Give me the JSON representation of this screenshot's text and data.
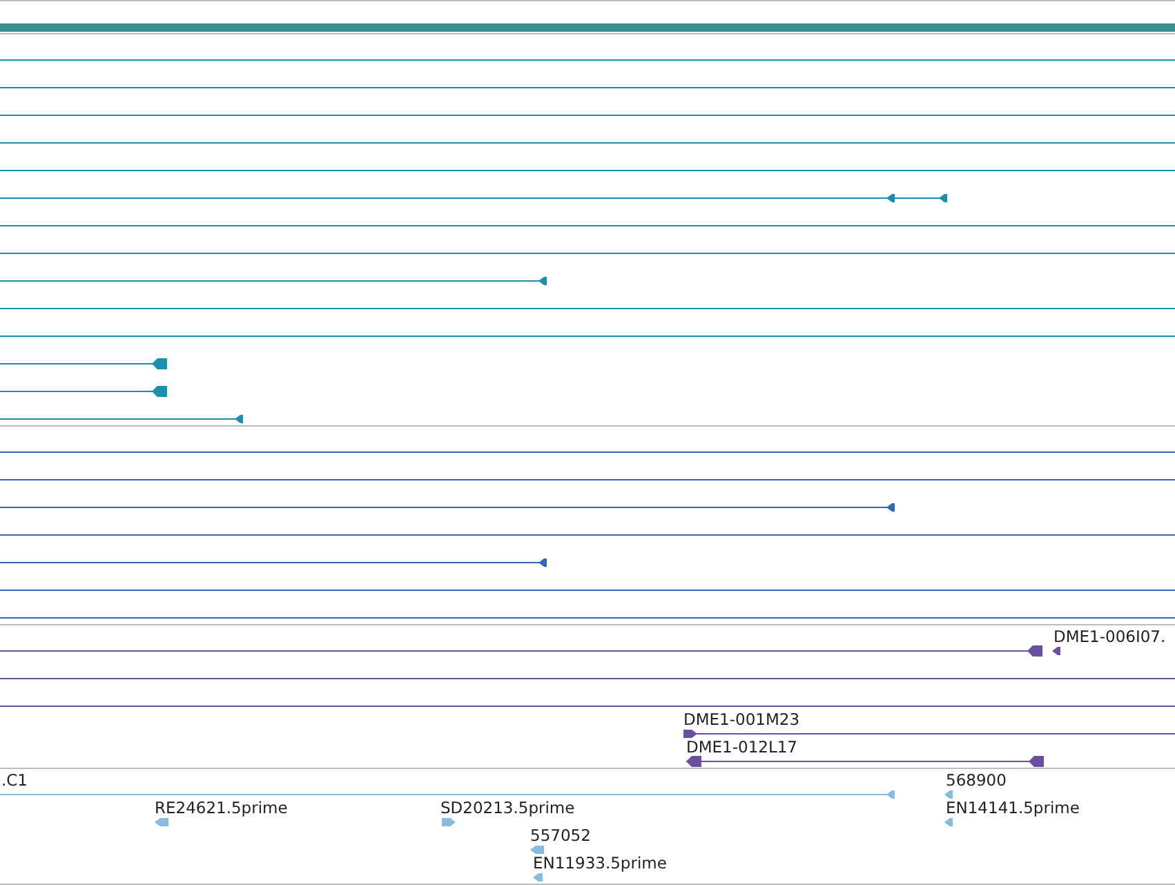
{
  "tracks": [
    {
      "color": "#1a8fb0"
    },
    {
      "color": "#3366bb"
    },
    {
      "color": "#6a4fa0",
      "labels": [
        {
          "text": "DME1-006I07.",
          "reverse": true
        },
        {
          "text": "DME1-001M23",
          "reverse": false
        },
        {
          "text": "DME1-012L17",
          "reverse": true
        }
      ]
    },
    {
      "color": "#88bbdd",
      "labels": [
        {
          "text": ".C1",
          "reverse": true
        },
        {
          "text": "568900",
          "reverse": true
        },
        {
          "text": "RE24621.5prime",
          "reverse": true
        },
        {
          "text": "SD20213.5prime",
          "reverse": false
        },
        {
          "text": "EN14141.5prime",
          "reverse": true
        },
        {
          "text": "557052",
          "reverse": true
        },
        {
          "text": "EN11933.5prime",
          "reverse": true
        }
      ]
    }
  ]
}
